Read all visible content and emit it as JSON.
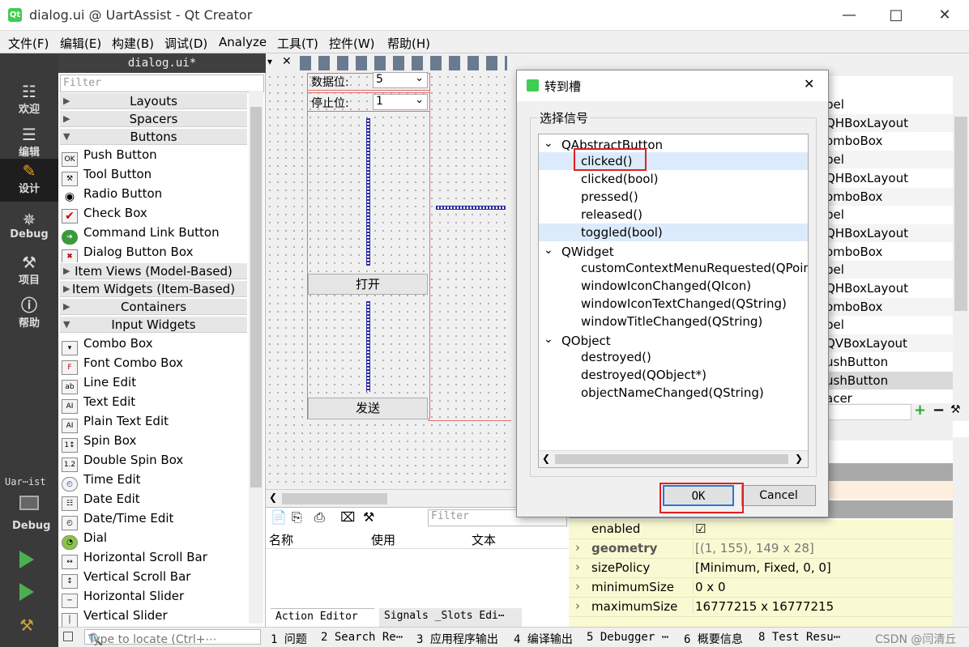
{
  "window": {
    "title": "dialog.ui @ UartAssist - Qt Creator",
    "app_icon": "Qt"
  },
  "menu": [
    "文件(F)",
    "编辑(E)",
    "构建(B)",
    "调试(D)",
    "Analyze",
    "工具(T)",
    "控件(W)",
    "帮助(H)"
  ],
  "modes": [
    {
      "label": "欢迎",
      "icon": "grid-icon"
    },
    {
      "label": "编辑",
      "icon": "document-icon"
    },
    {
      "label": "设计",
      "icon": "pencil-icon"
    },
    {
      "label": "Debug",
      "icon": "bug-icon"
    },
    {
      "label": "项目",
      "icon": "wrench-icon"
    },
    {
      "label": "帮助",
      "icon": "help-icon"
    }
  ],
  "kit": {
    "project": "Uar⋯ist",
    "mode": "Debug"
  },
  "editor": {
    "tab": "dialog.ui*",
    "filter_placeholder": "Filter"
  },
  "widgetbox": {
    "categories_top": [
      "Layouts",
      "Spacers",
      "Buttons"
    ],
    "buttons": [
      "Push Button",
      "Tool Button",
      "Radio Button",
      "Check Box",
      "Command Link Button",
      "Dialog Button Box"
    ],
    "categories_mid": [
      "Item Views (Model-Based)",
      "Item Widgets (Item-Based)",
      "Containers",
      "Input Widgets"
    ],
    "inputs": [
      "Combo Box",
      "Font Combo Box",
      "Line Edit",
      "Text Edit",
      "Plain Text Edit",
      "Spin Box",
      "Double Spin Box",
      "Time Edit",
      "Date Edit",
      "Date/Time Edit",
      "Dial",
      "Horizontal Scroll Bar",
      "Vertical Scroll Bar",
      "Horizontal Slider",
      "Vertical Slider"
    ]
  },
  "form": {
    "databits_label": "数据位:",
    "databits_value": "5",
    "stopbits_label": "停止位:",
    "stopbits_value": "1",
    "open_button": "打开",
    "send_button": "发送"
  },
  "action_editor": {
    "filter_placeholder": "Filter",
    "columns": [
      "名称",
      "使用",
      "文本"
    ],
    "tabs": [
      "Action Editor",
      "Signals _Slots Edi⋯"
    ]
  },
  "object_inspector": {
    "rows": [
      "bel",
      "QHBoxLayout",
      "omboBox",
      "bel",
      "QHBoxLayout",
      "omboBox",
      "bel",
      "QHBoxLayout",
      "omboBox",
      "bel",
      "QHBoxLayout",
      "omboBox",
      "bel",
      "QVBoxLayout",
      "ushButton",
      "ushButton",
      "acer"
    ]
  },
  "properties": [
    {
      "name": "enabled",
      "value": "☑"
    },
    {
      "name": "geometry",
      "value": "[(1, 155), 149 x 28]"
    },
    {
      "name": "sizePolicy",
      "value": "[Minimum, Fixed, 0, 0]"
    },
    {
      "name": "minimumSize",
      "value": "0 x 0"
    },
    {
      "name": "maximumSize",
      "value": "16777215 x 16777215"
    }
  ],
  "status": {
    "locate_placeholder": "Type to locate (Ctrl+⋯",
    "panes": [
      "1 问题",
      "2 Search Re⋯",
      "3 应用程序输出",
      "4 编译输出",
      "5 Debugger ⋯",
      "6 概要信息",
      "8 Test Resu⋯"
    ],
    "watermark": "CSDN @闫清丘"
  },
  "dialog": {
    "title": "转到槽",
    "group": "选择信号",
    "tree": [
      {
        "text": "QAbstractButton",
        "level": 0
      },
      {
        "text": "clicked()",
        "level": 1,
        "selected": true
      },
      {
        "text": "clicked(bool)",
        "level": 1
      },
      {
        "text": "pressed()",
        "level": 1
      },
      {
        "text": "released()",
        "level": 1
      },
      {
        "text": "toggled(bool)",
        "level": 1
      },
      {
        "text": "QWidget",
        "level": 0
      },
      {
        "text": "customContextMenuRequested(QPoin",
        "level": 1
      },
      {
        "text": "windowIconChanged(QIcon)",
        "level": 1
      },
      {
        "text": "windowIconTextChanged(QString)",
        "level": 1
      },
      {
        "text": "windowTitleChanged(QString)",
        "level": 1
      },
      {
        "text": "QObject",
        "level": 0
      },
      {
        "text": "destroyed()",
        "level": 1
      },
      {
        "text": "destroyed(QObject*)",
        "level": 1
      },
      {
        "text": "objectNameChanged(QString)",
        "level": 1
      }
    ],
    "ok": "OK",
    "cancel": "Cancel"
  },
  "colors": {
    "highlight": "#e02020",
    "selection": "#dcebfc",
    "property_bg": "#fafad2"
  }
}
